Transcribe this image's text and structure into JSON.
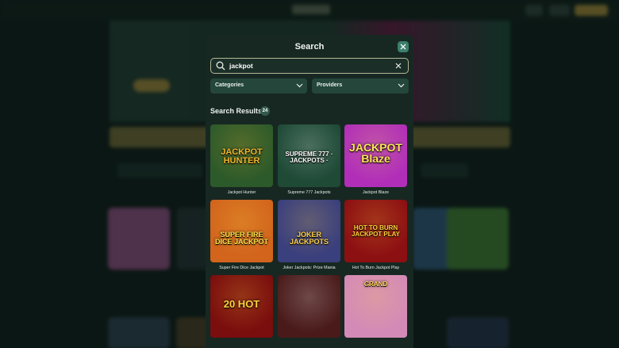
{
  "modal": {
    "title": "Search",
    "search": {
      "value": "jackpot",
      "placeholder": ""
    },
    "filters": [
      {
        "label": "Categories"
      },
      {
        "label": "Providers"
      }
    ],
    "results_title": "Search Results",
    "results_count": "24"
  },
  "games": [
    {
      "name": "Jackpot Hunter",
      "art": "JACKPOT HUNTER",
      "bg": "#2d5a2a",
      "accent": "#f0b52b"
    },
    {
      "name": "Supreme 777 Jackpots",
      "art": "SUPREME 777 · JACKPOTS ·",
      "bg": "#1e4a36",
      "accent": "#ffffff"
    },
    {
      "name": "Jackpot Blaze",
      "art": "JACKPOT Blaze",
      "bg": "#b12fb8",
      "accent": "#ffe45a"
    },
    {
      "name": "Super Fire Dice Jackpot",
      "art": "SUPER FIRE DICE JACKPOT",
      "bg": "#d2641c",
      "accent": "#ffe24a"
    },
    {
      "name": "Joker Jackpots: Prize Mania",
      "art": "JOKER JACKPOTS",
      "bg": "#3a3f7d",
      "accent": "#ffd34a"
    },
    {
      "name": "Hot To Burn Jackpot Play",
      "art": "HOT TO BURN JACKPOT PLAY",
      "bg": "#8c0f12",
      "accent": "#ffcf3a"
    },
    {
      "name": "",
      "art": "20 HOT",
      "bg": "#7a0d0d",
      "accent": "#ffd23d"
    },
    {
      "name": "",
      "art": "",
      "bg": "#4a1a1a",
      "accent": "#ffffff"
    },
    {
      "name": "",
      "art": "GRAND",
      "bg": "#d48ab6",
      "accent": "#ffd45a"
    }
  ],
  "colors": {
    "modal_bg": "#172822",
    "accent_green": "#3c7f6d",
    "dropdown_bg": "#24463b"
  },
  "icons": [
    "search-icon",
    "close-icon",
    "clear-icon",
    "chevron-down-icon"
  ]
}
